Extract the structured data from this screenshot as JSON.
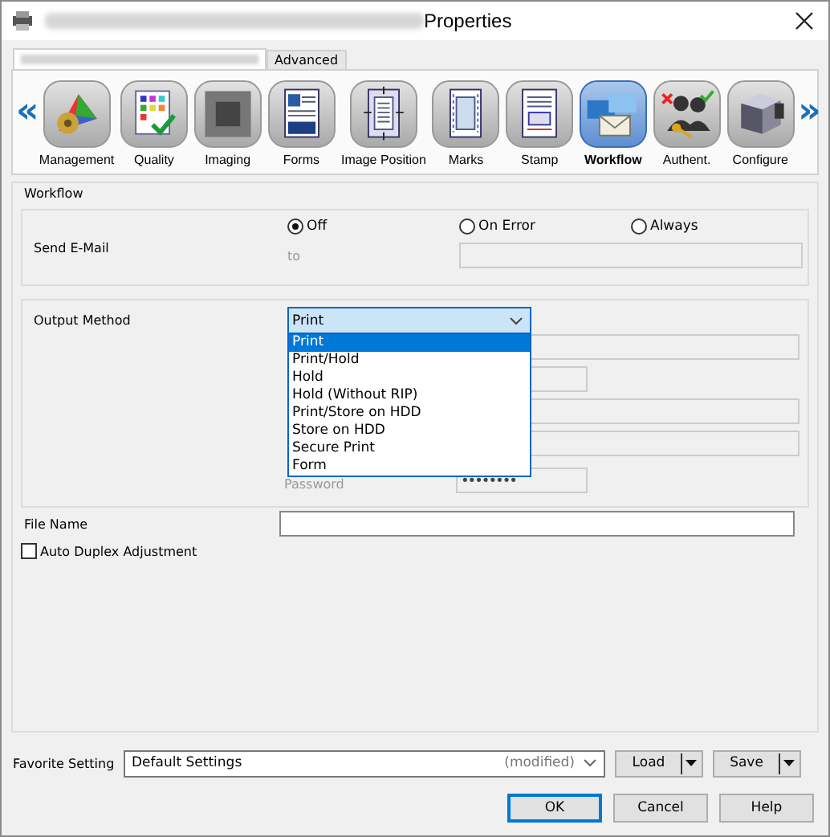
{
  "window": {
    "title": "Properties"
  },
  "tabs": [
    {
      "kind": "redacted",
      "selected": true
    },
    {
      "kind": "text",
      "label": "Advanced",
      "selected": false
    }
  ],
  "categories": [
    {
      "label": "Management",
      "selected": false
    },
    {
      "label": "Quality",
      "selected": false
    },
    {
      "label": "Imaging",
      "selected": false
    },
    {
      "label": "Forms",
      "selected": false
    },
    {
      "label": "Image Position",
      "selected": false
    },
    {
      "label": "Marks",
      "selected": false
    },
    {
      "label": "Stamp",
      "selected": false
    },
    {
      "label": "Workflow",
      "selected": true
    },
    {
      "label": "Authent.",
      "selected": false
    },
    {
      "label": "Configure",
      "selected": false
    }
  ],
  "scroll_left": "«",
  "scroll_right": "»",
  "group_title": "Workflow",
  "send_email": {
    "label": "Send E-Mail",
    "options": [
      {
        "label": "Off",
        "selected": true
      },
      {
        "label": "On Error",
        "selected": false
      },
      {
        "label": "Always",
        "selected": false
      }
    ],
    "to_label": "to",
    "to_disabled": true
  },
  "output_method": {
    "label": "Output Method",
    "value": "Print",
    "expanded": true,
    "options": [
      {
        "label": "Print",
        "selected": true
      },
      {
        "label": "Print/Hold",
        "selected": false
      },
      {
        "label": "Hold",
        "selected": false
      },
      {
        "label": "Hold (Without RIP)",
        "selected": false
      },
      {
        "label": "Print/Store on HDD",
        "selected": false
      },
      {
        "label": "Store on HDD",
        "selected": false
      },
      {
        "label": "Secure Print",
        "selected": false
      },
      {
        "label": "Form",
        "selected": false
      }
    ],
    "password_label": "Password",
    "password_value": "••••••••"
  },
  "file_name": {
    "label": "File Name"
  },
  "auto_duplex": {
    "label": "Auto Duplex Adjustment",
    "checked": false
  },
  "favorite": {
    "label": "Favorite Setting",
    "value": "Default Settings",
    "note": "(modified)",
    "buttons": [
      "Load",
      "Save"
    ]
  },
  "buttons": [
    "OK",
    "Cancel",
    "Help"
  ]
}
